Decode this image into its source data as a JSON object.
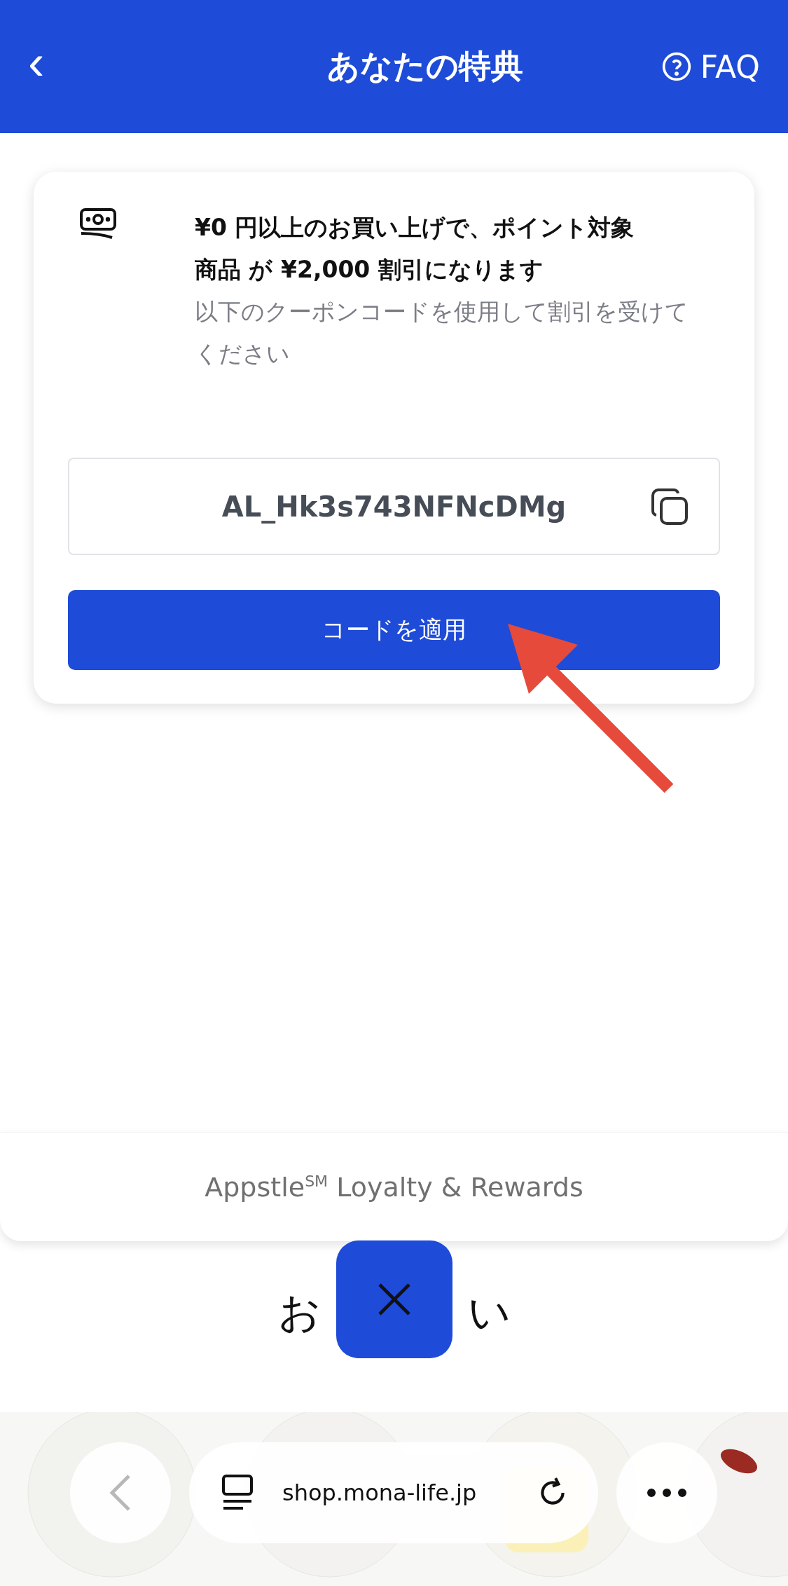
{
  "header": {
    "back": "‹",
    "title": "あなたの特典",
    "faq": "FAQ"
  },
  "reward": {
    "headline_1": "¥0 円以上のお買い上げで、ポイント対象",
    "headline_2": "商品 が ¥2,000 割引になります",
    "note": "以下のクーポンコードを使用して割引を受けてください",
    "code": "AL_Hk3s743NFNcDMg",
    "apply": "コードを適用"
  },
  "footer": {
    "brand": "Appstle$^{SM}$ Loyalty & Rewards"
  },
  "page_behind": {
    "heading_left": "お",
    "heading_right": "い"
  },
  "browser_bar": {
    "url": "shop.mona-life.jp"
  }
}
